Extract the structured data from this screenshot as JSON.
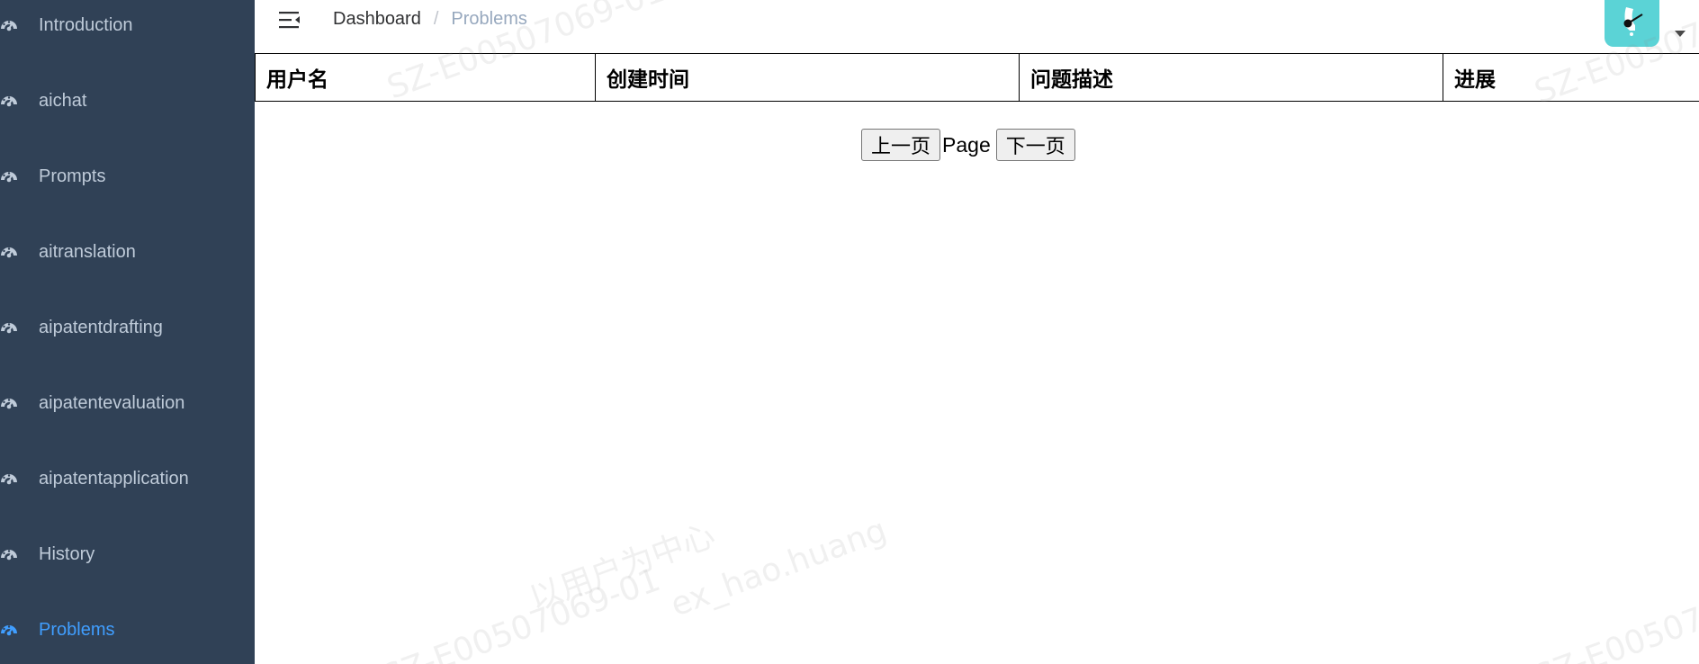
{
  "sidebar": {
    "items": [
      {
        "label": "Introduction",
        "icon": "dashboard-icon",
        "active": false
      },
      {
        "label": "aichat",
        "icon": "dashboard-icon",
        "active": false
      },
      {
        "label": "Prompts",
        "icon": "dashboard-icon",
        "active": false
      },
      {
        "label": "aitranslation",
        "icon": "dashboard-icon",
        "active": false
      },
      {
        "label": "aipatentdrafting",
        "icon": "dashboard-icon",
        "active": false
      },
      {
        "label": "aipatentevaluation",
        "icon": "dashboard-icon",
        "active": false
      },
      {
        "label": "aipatentapplication",
        "icon": "dashboard-icon",
        "active": false
      },
      {
        "label": "History",
        "icon": "dashboard-icon",
        "active": false
      },
      {
        "label": "Problems",
        "icon": "dashboard-icon",
        "active": true
      }
    ]
  },
  "navbar": {
    "hamburger_icon": "hamburger-icon",
    "breadcrumb": {
      "items": [
        "Dashboard",
        "Problems"
      ],
      "separator": "/"
    },
    "avatar_icon": "avatar-icon",
    "dropdown_icon": "caret-down-icon"
  },
  "table": {
    "headers": [
      "用户名",
      "创建时间",
      "问题描述",
      "进展"
    ]
  },
  "pagination": {
    "prev_label": "上一页",
    "page_label": "Page",
    "next_label": "下一页"
  },
  "watermark": {
    "lines": [
      "SZ-E00507069-01",
      "以用户为中心",
      "ex_hao.huang",
      "SZ-E00507069-01，ex_hao.huang"
    ]
  },
  "colors": {
    "sidebar_bg": "#304156",
    "sidebar_text": "#bfcbd9",
    "active_text": "#409eff",
    "avatar_bg": "#5bd3d6"
  }
}
